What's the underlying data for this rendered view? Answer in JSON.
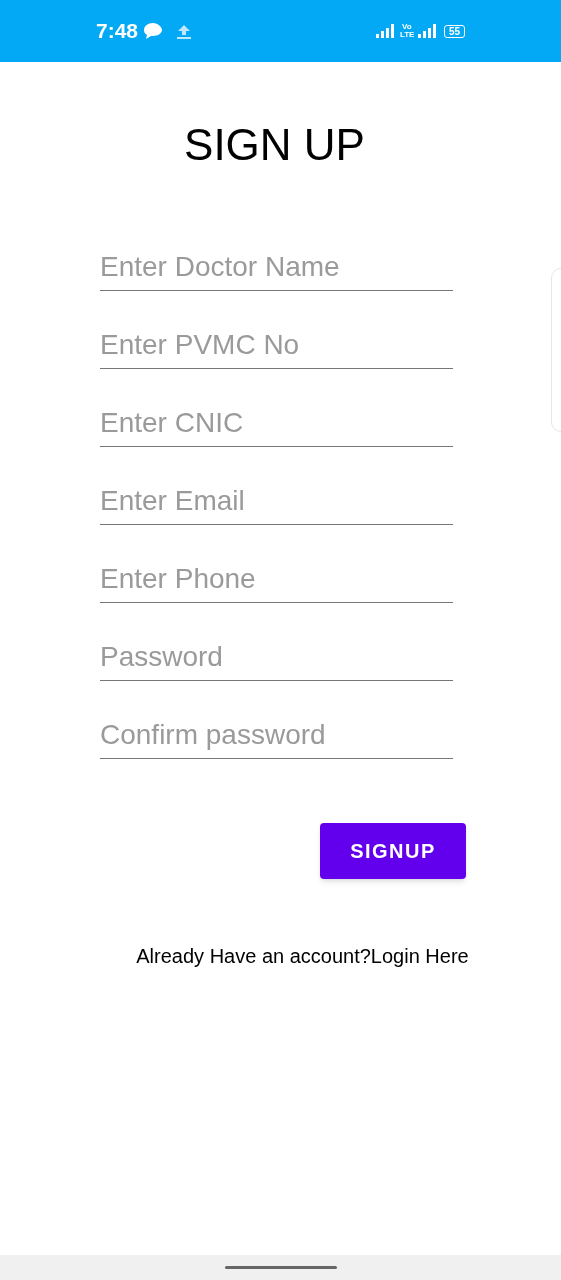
{
  "status_bar": {
    "time": "7:48",
    "network": "Vo LTE",
    "battery": "55"
  },
  "title": "SIGN UP",
  "fields": [
    {
      "placeholder": "Enter Doctor Name"
    },
    {
      "placeholder": "Enter PVMC No"
    },
    {
      "placeholder": "Enter CNIC"
    },
    {
      "placeholder": "Enter Email"
    },
    {
      "placeholder": "Enter Phone"
    },
    {
      "placeholder": "Password"
    },
    {
      "placeholder": "Confirm password"
    }
  ],
  "signup_button": "SIGNUP",
  "login_link": "Already Have an account?Login Here"
}
